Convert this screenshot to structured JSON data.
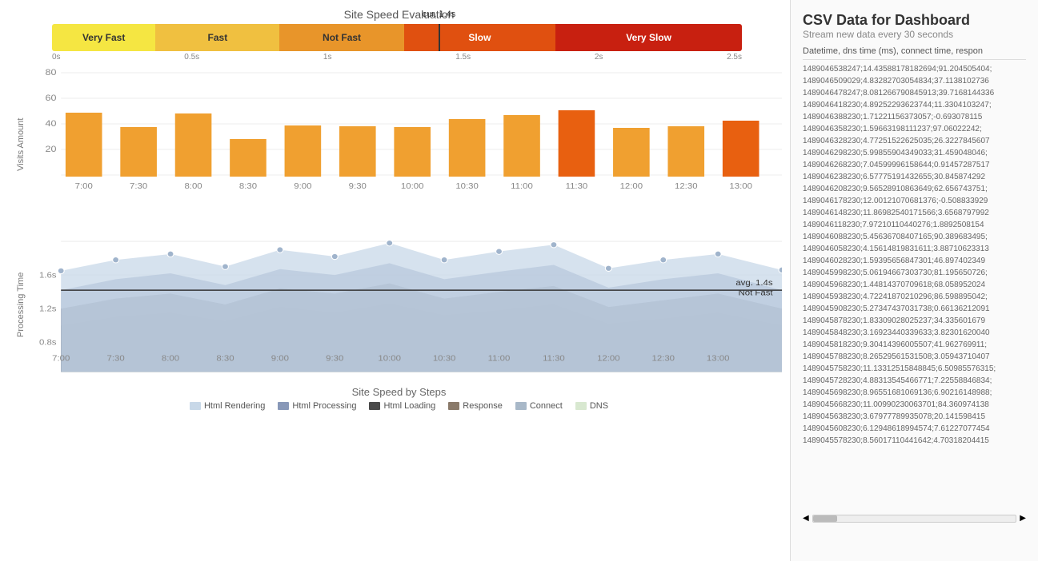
{
  "title": "Site Speed Evaluation",
  "cursor_label": "cur. 1.4s",
  "speed_segments": [
    {
      "label": "Very Fast",
      "color": "#f5e642",
      "width": 15
    },
    {
      "label": "Fast",
      "color": "#f0c040",
      "width": 18
    },
    {
      "label": "Not Fast",
      "color": "#e8952a",
      "width": 18
    },
    {
      "label": "Slow",
      "color": "#e05010",
      "width": 22
    },
    {
      "label": "Very Slow",
      "color": "#c82010",
      "width": 27
    }
  ],
  "speed_axis": [
    "0s",
    "0.5s",
    "1s",
    "1.5s",
    "2s",
    "2.5s"
  ],
  "y_axis_bar": [
    "80",
    "60",
    "40",
    "20"
  ],
  "x_axis_time": [
    "7:00",
    "7:30",
    "8:00",
    "8:30",
    "9:00",
    "9:30",
    "10:00",
    "10:30",
    "11:00",
    "11:30",
    "12:00",
    "12:30",
    "13:00"
  ],
  "bar_visits_label": "Visits Amount",
  "area_processing_label": "Processing Time",
  "avg_label": "avg. 1.4s",
  "not_fast_label": "Not Fast",
  "bottom_chart_label": "Site Speed by Steps",
  "legend": [
    {
      "label": "Html Rendering",
      "color": "#c8d8e8"
    },
    {
      "label": "Html Processing",
      "color": "#8898b8"
    },
    {
      "label": "Html Loading",
      "color": "#4a4a4a"
    },
    {
      "label": "Response",
      "color": "#7a6a5a"
    },
    {
      "label": "Connect",
      "color": "#a8b8c8"
    },
    {
      "label": "DNS",
      "color": "#d8e8d0"
    }
  ],
  "csv_panel": {
    "title": "CSV Data for Dashboard",
    "subtitle": "Stream new data every 30 seconds",
    "header": "Datetime, dns time (ms), connect time, respon",
    "rows": [
      "1489046538247;14.43588178182694;91.204505404;",
      "1489046509029;4.83282703054834;37.1138102736",
      "1489046478247;8.081266790845913;39.7168144336",
      "1489046418230;4.89252293623744;11.3304103247;",
      "1489046388230;1.71221156373057;-0.693078115",
      "1489046358230;1.59663198111237;97.06022242;",
      "1489046328230;4.77251522625035;26.3227845607",
      "1489046298230;5.99855904349033;31.459048046;",
      "1489046268230;7.04599996158644;0.91457287517",
      "1489046238230;6.57775191432655;30.845874292",
      "1489046208230;9.56528910863649;62.656743751;",
      "1489046178230;12.00121070681376;-0.508833929",
      "1489046148230;11.86982540171566;3.6568797992",
      "1489046118230;7.97210110440276;1.8892508154",
      "1489046088230;5.45636708407165;90.389683495;",
      "1489046058230;4.15614819831611;3.88710623313",
      "1489046028230;1.59395656847301;46.897402349",
      "1489045998230;5.06194667303730;81.195650726;",
      "1489045968230;1.44814370709618;68.058952024",
      "1489045938230;4.72241870210296;86.598895042;",
      "1489045908230;5.27347437031738;0.66136212091",
      "1489045878230;1.83309028025237;34.335601679",
      "1489045848230;3.16923440339633;3.82301620040",
      "1489045818230;9.30414396005507;41.962769911;",
      "1489045788230;8.26529561531508;3.05943710407",
      "1489045758230;11.13312515848845;6.50985576315;",
      "1489045728230;4.88313545466771;7.22558846834;",
      "1489045698230;8.96551681069136;6.90216148988;",
      "1489045668230;11.00990230063701;84.360974138",
      "1489045638230;3.67977789935078;20.141598415",
      "1489045608230;6.12948618994574;7.61227077454",
      "1489045578230;8.56017110441642;4.70318204415"
    ]
  }
}
